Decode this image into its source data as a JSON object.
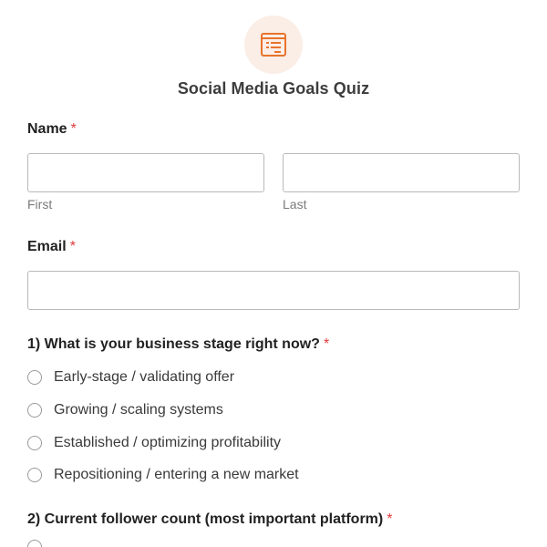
{
  "header": {
    "icon": "form-list-icon",
    "icon_color": "#e8732c",
    "icon_bg": "#fbeee6",
    "title": "Social Media Goals Quiz"
  },
  "name_field": {
    "label": "Name",
    "required_mark": "*",
    "first_value": "",
    "last_value": "",
    "first_sublabel": "First",
    "last_sublabel": "Last"
  },
  "email_field": {
    "label": "Email",
    "required_mark": "*",
    "value": ""
  },
  "question1": {
    "label": "1) What is your business stage right now?",
    "required_mark": "*",
    "options": [
      "Early-stage / validating offer",
      "Growing / scaling systems",
      "Established / optimizing profitability",
      "Repositioning / entering a new market"
    ]
  },
  "question2": {
    "label": "2) Current follower count (most important platform)",
    "required_mark": "*"
  },
  "colors": {
    "required": "#e03a3a",
    "input_border": "#b9b9b9"
  }
}
